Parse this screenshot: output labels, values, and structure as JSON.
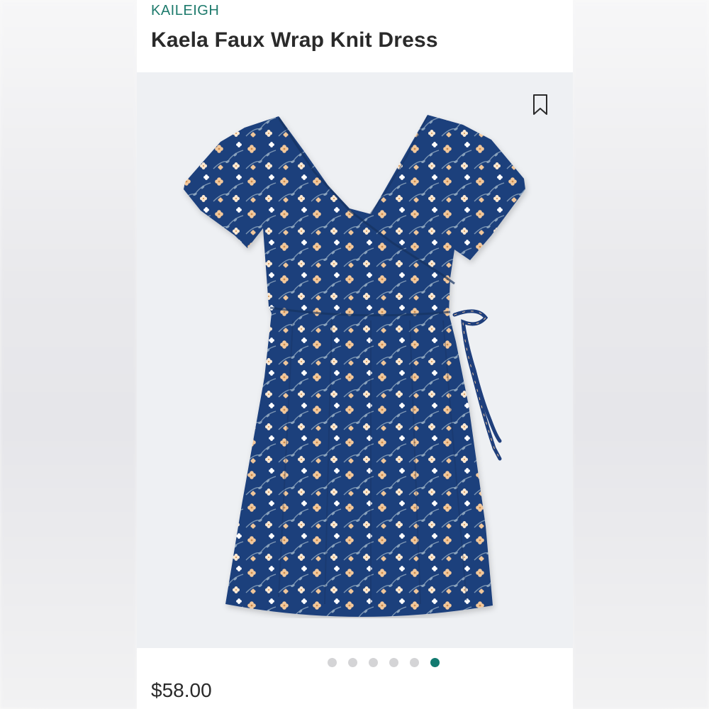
{
  "product": {
    "brand": "KAILEIGH",
    "title": "Kaela Faux Wrap Knit Dress",
    "price": "$58.00"
  },
  "image": {
    "alt": "Navy floral faux wrap knit dress",
    "dress_color": "#1f3f7c",
    "flower_colors": [
      "#f2c89b",
      "#fbe8d2",
      "#ffffff",
      "#9db2c6"
    ],
    "bookmark_icon": "bookmark-icon"
  },
  "carousel": {
    "count": 6,
    "active_index": 5,
    "active_color": "#127a70",
    "inactive_color": "#d4d4d6"
  }
}
